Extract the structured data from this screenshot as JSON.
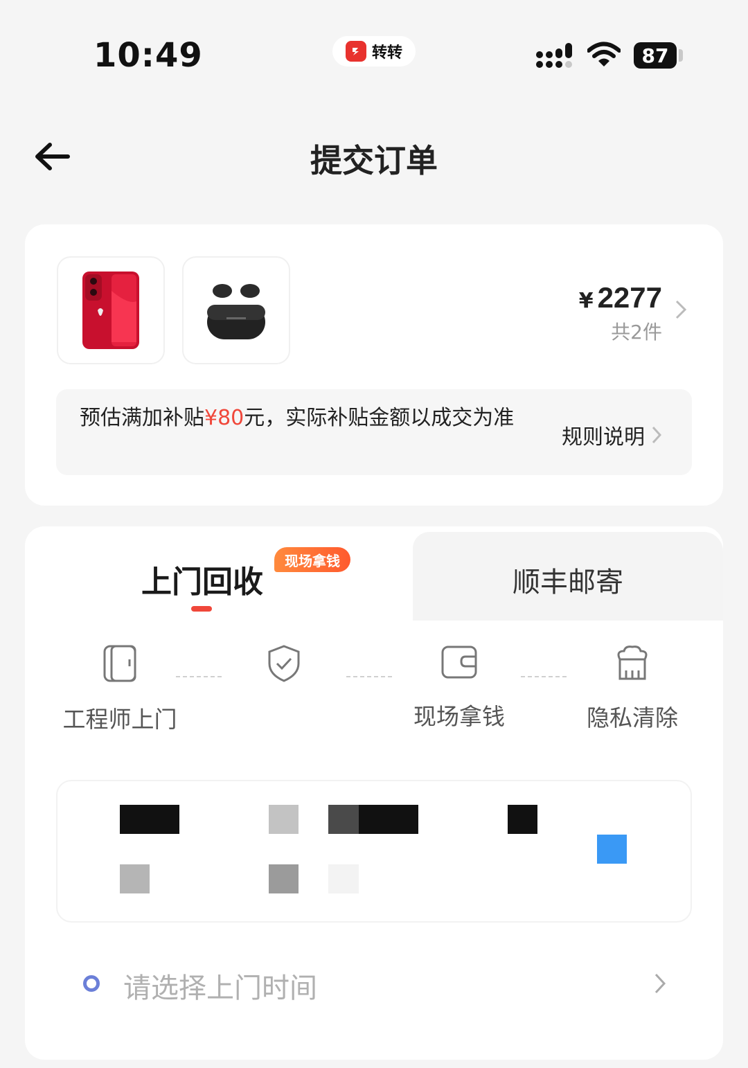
{
  "status_bar": {
    "time": "10:49",
    "app_name": "转转",
    "battery": "87",
    "icons": [
      "signal-icon",
      "wifi-icon",
      "battery-icon"
    ]
  },
  "nav": {
    "title": "提交订单",
    "back_icon": "arrow-left-icon"
  },
  "order": {
    "thumbnails": [
      "phone-image",
      "earbuds-image"
    ],
    "price_symbol": "¥",
    "price": "2277",
    "item_count": "共2件",
    "subsidy": {
      "text_before": "预估满加补贴",
      "amount": "¥80",
      "text_after": "元，实际补贴金额以成交为准",
      "rule_link": "规则说明"
    }
  },
  "delivery": {
    "tabs": [
      {
        "label": "上门回收",
        "badge": "现场拿钱",
        "active": true
      },
      {
        "label": "顺丰邮寄",
        "active": false
      }
    ],
    "steps": [
      {
        "label": "工程师上门",
        "icon": "phone-icon"
      },
      {
        "label": "",
        "icon": "shield-check-icon"
      },
      {
        "label": "现场拿钱",
        "icon": "wallet-icon"
      },
      {
        "label": "隐私清除",
        "icon": "cleaning-icon"
      }
    ],
    "time_placeholder": "请选择上门时间"
  },
  "colors": {
    "accent_red": "#f0473a",
    "badge_orange": "#ff7a35",
    "dot_blue": "#6b7fd8",
    "background": "#f5f5f5"
  }
}
